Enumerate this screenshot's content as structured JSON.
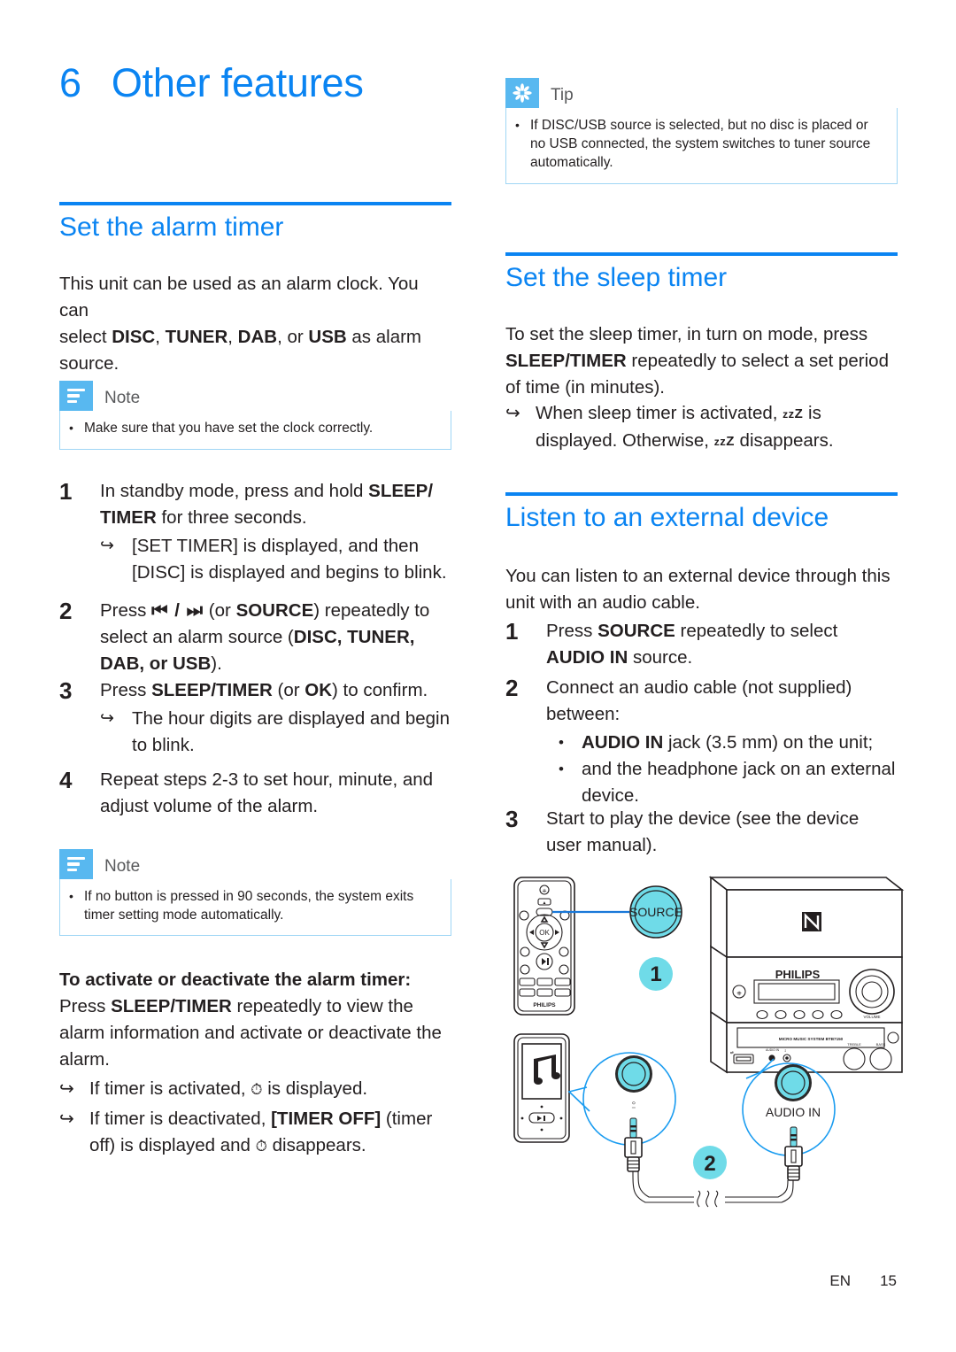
{
  "page": {
    "chapter_number": "6",
    "chapter_title": "Other features",
    "footer_lang": "EN",
    "footer_page": "15",
    "accent_blue": "#0a84f2",
    "callout_blue": "#58b8f0",
    "callout_border": "#9fd6f5",
    "diagram_cyan": "#4fd2e3",
    "diagram_outline_blue": "#1a9cf0"
  },
  "left_column": {
    "section_alarm": {
      "title": "Set the alarm timer",
      "intro_line1": "This unit can be used as an alarm clock. You can",
      "intro_line2_pre": "select ",
      "intro_bold_a": "DISC",
      "intro_sep_a": ", ",
      "intro_bold_b": "TUNER",
      "intro_sep_b": ", ",
      "intro_bold_c": "DAB",
      "intro_sep_c": ", or ",
      "intro_bold_d": "USB",
      "intro_line2_post": " as alarm",
      "intro_line3": "source."
    },
    "note1": {
      "label": "Note",
      "icon": "note-lines-icon",
      "items": [
        "Make sure that you have set the clock correctly."
      ]
    },
    "steps": [
      {
        "num": "1",
        "text_pre": "In standby mode, press and hold ",
        "bold": "SLEEP/ TIMER",
        "text_post": " for three seconds.",
        "subs": [
          "[SET TIMER] is displayed, and then [DISC] is displayed and begins to blink."
        ]
      },
      {
        "num": "2",
        "text_pre": "Press ",
        "bold": "⏮ / ⏭",
        "text_mid": " (or ",
        "bold2": "SOURCE",
        "text_post": ") repeatedly to select an alarm source (",
        "sources": "DISC, TUNER, DAB, or USB",
        "text_end": ").",
        "subs": []
      },
      {
        "num": "3",
        "text_pre": "Press ",
        "bold": "SLEEP/TIMER",
        "text_mid": " (or ",
        "bold2": "OK",
        "text_post": ") to confirm.",
        "subs": [
          "The hour digits are displayed and begin to blink."
        ]
      },
      {
        "num": "4",
        "text_pre": "Repeat steps 2-3 to set hour, minute, and adjust volume of the alarm.",
        "subs": []
      }
    ],
    "note2": {
      "label": "Note",
      "icon": "note-lines-icon",
      "items": [
        "If no button is pressed in 90 seconds, the system exits timer setting mode automatically."
      ]
    },
    "activate_block": {
      "heading": "To activate or deactivate the alarm timer:",
      "para_pre": "Press ",
      "para_bold": "SLEEP/TIMER",
      "para_post": " repeatedly to view the alarm information and activate or deactivate the alarm.",
      "arrow1_pre": "If timer is activated, ",
      "arrow1_icon": "alarm-bell-icon",
      "arrow1_post": " is displayed.",
      "arrow2_pre": "If timer is deactivated, ",
      "arrow2_bold": "[TIMER OFF]",
      "arrow2_mid": " (timer off) is displayed and ",
      "arrow2_icon": "alarm-bell-icon",
      "arrow2_post": " disappears."
    }
  },
  "right_column": {
    "tip": {
      "label": "Tip",
      "icon": "tip-asterisk-icon",
      "items": [
        "If DISC/USB source is selected, but no disc is placed or no USB connected, the system switches to tuner source automatically."
      ]
    },
    "section_sleep": {
      "title": "Set the sleep timer",
      "para_pre": "To set the sleep timer, in turn on mode, press ",
      "para_bold": "SLEEP/TIMER",
      "para_post": " repeatedly to select a set period of time (in minutes).",
      "arrow_pre": "When sleep timer is activated, ",
      "arrow_icon": "zzz-icon",
      "arrow_mid": " is displayed. Otherwise, ",
      "arrow_icon2": "zzz-icon",
      "arrow_post": " disappears."
    },
    "section_external": {
      "title": "Listen to an external device",
      "intro": "You can listen to an external device through this unit with an audio cable.",
      "steps": [
        {
          "num": "1",
          "text_pre": "Press ",
          "bold": "SOURCE",
          "text_mid": " repeatedly to select ",
          "bold2": "AUDIO IN",
          "text_post": " source.",
          "bullets": []
        },
        {
          "num": "2",
          "text_pre": "Connect an audio cable (not supplied) between:",
          "bullets": [
            {
              "bold": "AUDIO IN",
              "rest": " jack (3.5 mm) on the unit;"
            },
            {
              "bold": "",
              "rest": "and the headphone jack on an external device."
            }
          ]
        },
        {
          "num": "3",
          "text_pre": "Start to play the device (see the device user manual).",
          "bullets": []
        }
      ]
    },
    "diagram": {
      "name": "audio-in-connection-diagram",
      "callout_source": "SOURCE",
      "callout_audio_in": "AUDIO IN",
      "badge_one": "1",
      "badge_two": "2",
      "remote_brand": "PHILIPS",
      "remote_ok": "OK",
      "unit_brand": "PHILIPS",
      "unit_model_text": "MICRO MUSIC SYSTEM BTB7150",
      "unit_volume_label": "VOLUME",
      "unit_treble_label": "TREBLE",
      "unit_bass_label": "BASS",
      "jack_headphone_label": "headphone-icon",
      "nfc_label": "nfc-icon",
      "player_icon": "music-note-icon",
      "player_playpause": "play-pause-icon"
    }
  }
}
